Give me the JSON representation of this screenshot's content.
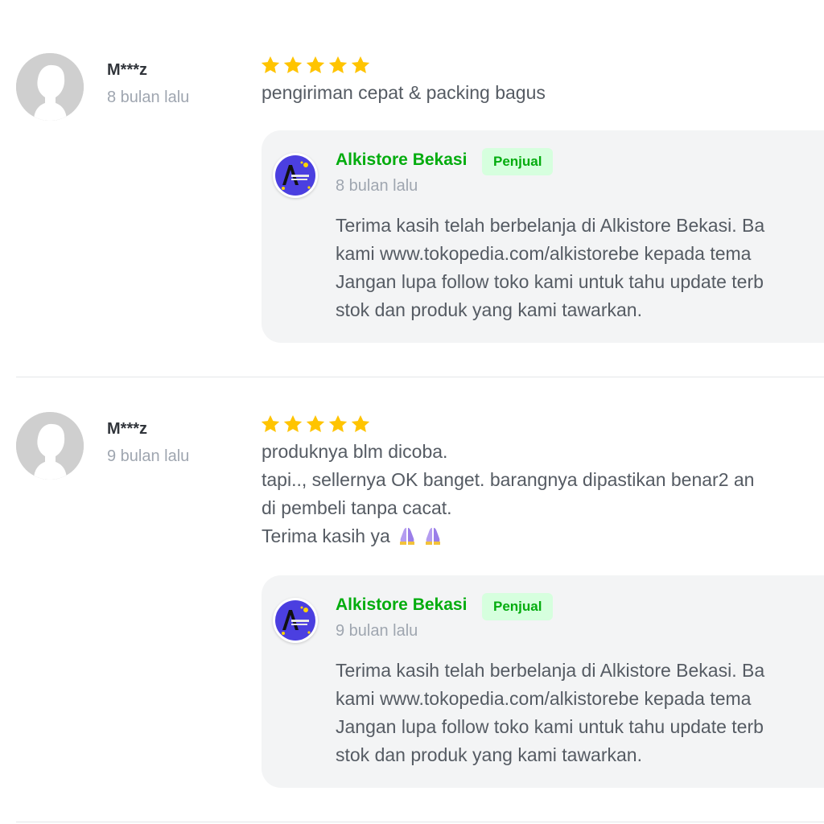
{
  "reviews": [
    {
      "reviewer": "M***z",
      "time": "8 bulan lalu",
      "rating": 5,
      "text_lines": [
        "pengiriman cepat & packing bagus"
      ],
      "reply": {
        "seller": "Alkistore Bekasi",
        "badge": "Penjual",
        "time": "8 bulan lalu",
        "text_lines": [
          "Terima kasih telah berbelanja di Alkistore Bekasi. Ba",
          "kami www.tokopedia.com/alkistorebe kepada tema",
          "Jangan lupa follow toko kami untuk tahu update terb",
          "stok dan produk yang kami tawarkan."
        ]
      }
    },
    {
      "reviewer": "M***z",
      "time": "9 bulan lalu",
      "rating": 5,
      "text_lines": [
        "produknya blm dicoba.",
        "tapi.., sellernya OK banget. barangnya dipastikan benar2 an",
        "di pembeli tanpa cacat.",
        "Terima kasih ya"
      ],
      "text_emoji": [
        "folded-hands-emoji",
        "folded-hands-emoji"
      ],
      "reply": {
        "seller": "Alkistore Bekasi",
        "badge": "Penjual",
        "time": "9 bulan lalu",
        "text_lines": [
          "Terima kasih telah berbelanja di Alkistore Bekasi. Ba",
          "kami www.tokopedia.com/alkistorebe kepada tema",
          "Jangan lupa follow toko kami untuk tahu update terb",
          "stok dan produk yang kami tawarkan."
        ]
      }
    }
  ],
  "icons": {
    "avatar": "default-user-avatar-icon",
    "star": "star-icon",
    "seller_logo": "alkistore-logo"
  },
  "colors": {
    "star": "#ffc400",
    "seller_name": "#03ac0e",
    "badge_bg": "#d6ffde",
    "reply_bg": "#f3f4f5",
    "text": "#555b63",
    "muted": "#9fa6b0",
    "logo_bg": "#4b3fe0"
  }
}
